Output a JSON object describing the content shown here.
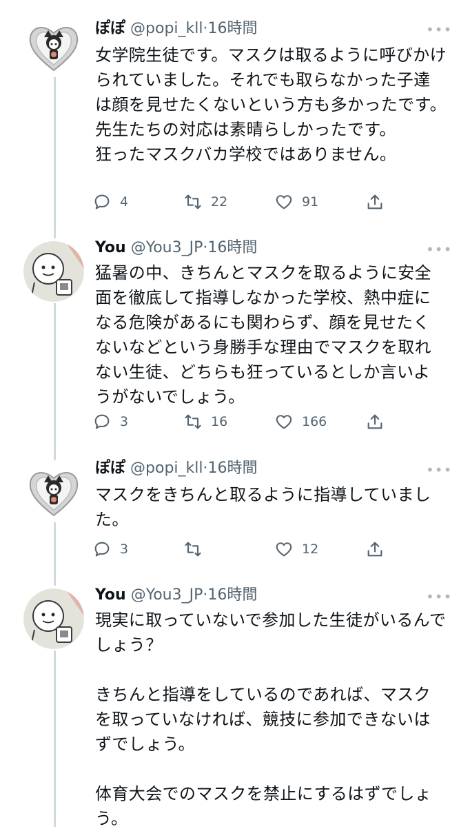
{
  "colors": {
    "text": "#0f1419",
    "secondary": "#536471",
    "thread_line": "#cfd9de"
  },
  "tweets": [
    {
      "avatar": "kuromi-heart-avatar",
      "name": "ぽぽ",
      "handle_time": "@popi_kll·16時間",
      "text": "女学院生徒です。マスクは取るように呼びかけられていました。それでも取らなかった子達は顔を見せたくないという方も多かったです。\n先生たちの対応は素晴らしかったです。\n狂ったマスクバカ学校ではありません。",
      "replies": "4",
      "retweets": "22",
      "likes": "91"
    },
    {
      "avatar": "cartoon-face-avatar",
      "name": "You",
      "handle_time": "@You3_JP·16時間",
      "text": "猛暑の中、きちんとマスクを取るように安全面を徹底して指導しなかった学校、熱中症になる危険があるにも関わらず、顔を見せたくないなどという身勝手な理由でマスクを取れない生徒、どちらも狂っているとしか言いようがないでしょう。",
      "replies": "3",
      "retweets": "16",
      "likes": "166"
    },
    {
      "avatar": "kuromi-heart-avatar",
      "name": "ぽぽ",
      "handle_time": "@popi_kll·16時間",
      "text": "マスクをきちんと取るように指導していました。",
      "replies": "3",
      "retweets": "",
      "likes": "12"
    },
    {
      "avatar": "cartoon-face-avatar",
      "name": "You",
      "handle_time": "@You3_JP·16時間",
      "text": "現実に取っていないで参加した生徒がいるんでしょう？\n\nきちんと指導をしているのであれば、マスクを取っていなければ、競技に参加できないはずでしょう。\n\n体育大会でのマスクを禁止にするはずでしょう。"
    }
  ]
}
